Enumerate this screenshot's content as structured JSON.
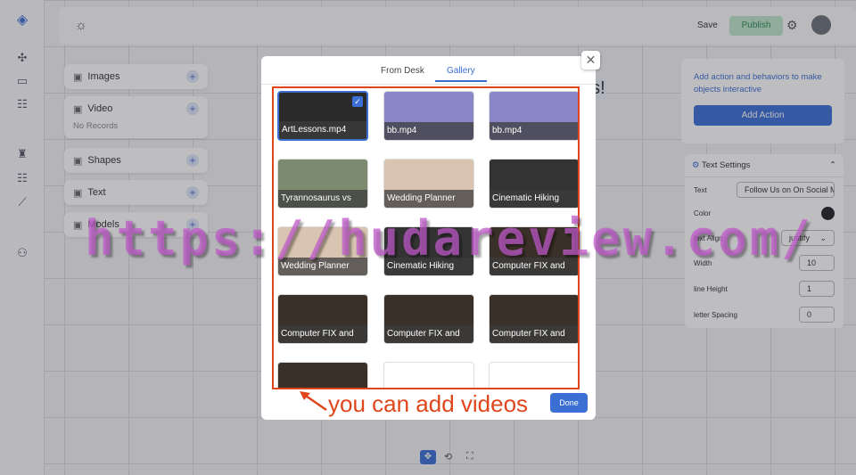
{
  "topbar": {
    "save": "Save",
    "publish": "Publish"
  },
  "left_panels": [
    {
      "label": "Images",
      "icon": "image-icon"
    },
    {
      "label": "Video",
      "icon": "video-icon",
      "empty": "No Records"
    },
    {
      "label": "Shapes",
      "icon": "shapes-icon"
    },
    {
      "label": "Text",
      "icon": "text-icon"
    },
    {
      "label": "Models",
      "icon": "cube-icon"
    }
  ],
  "canvas_text": "es!",
  "action_panel": {
    "hint": "Add action and behaviors to make objects interactive",
    "button": "Add Action"
  },
  "text_settings": {
    "title": "Text Settings",
    "text_label": "Text",
    "text_value": "Follow Us on On Social Media",
    "color_label": "Color",
    "color_value": "#222428",
    "align_label": "text Align",
    "align_value": "justify",
    "width_label": "Width",
    "width_value": "10",
    "lineheight_label": "line Height",
    "lineheight_value": "1",
    "spacing_label": "letter Spacing",
    "spacing_value": "0"
  },
  "modal": {
    "tabs": [
      "From Desk",
      "Gallery"
    ],
    "active_tab": "Gallery",
    "done": "Done",
    "items": [
      {
        "name": "ArtLessons.mp4",
        "selected": true,
        "color": "#2a2a2a"
      },
      {
        "name": "bb.mp4",
        "color": "#8a86c8"
      },
      {
        "name": "bb.mp4",
        "color": "#8a86c8"
      },
      {
        "name": "Tyrannosaurus vs",
        "color": "#7c8a70"
      },
      {
        "name": "Wedding Planner",
        "color": "#d8c4b0"
      },
      {
        "name": "Cinematic Hiking",
        "color": "#333"
      },
      {
        "name": "Wedding Planner",
        "color": "#d8c4b0"
      },
      {
        "name": "Cinematic Hiking",
        "color": "#333"
      },
      {
        "name": "Computer FIX and",
        "color": "#3a3028"
      },
      {
        "name": "Computer FIX and",
        "color": "#3a3028"
      },
      {
        "name": "Computer FIX and",
        "color": "#3a3028"
      },
      {
        "name": "Computer FIX and",
        "color": "#3a3028"
      },
      {
        "name": "",
        "color": "#3a3028"
      },
      {
        "name": "",
        "color": "#ffffff"
      },
      {
        "name": "",
        "color": "#ffffff"
      }
    ]
  },
  "annotation": "you can add videos",
  "watermark": "https://hudareview.com/",
  "colors": {
    "accent": "#3b6fd4",
    "annotation": "#e0461c"
  }
}
